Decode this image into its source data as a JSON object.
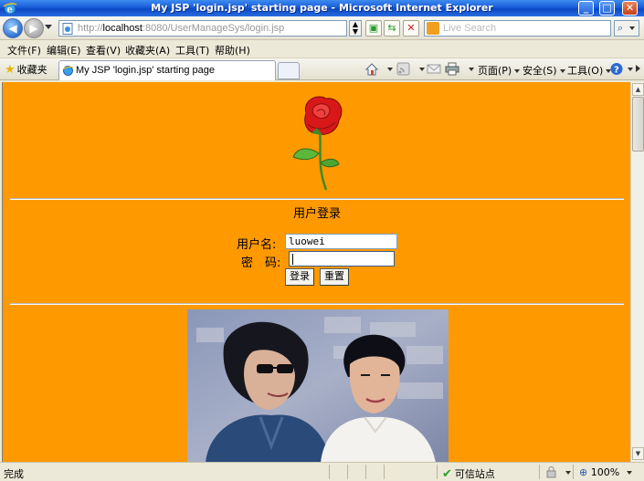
{
  "window": {
    "title": "My JSP 'login.jsp' starting page - Microsoft Internet Explorer",
    "minimize": "_",
    "maximize": "□",
    "close": "✕"
  },
  "addressbar": {
    "url_prefix": "http://",
    "url_host": "localhost",
    "url_rest": ":8080/UserManageSys/login.jsp",
    "search_placeholder": "Live Search"
  },
  "menu": {
    "file": "文件(F)",
    "edit": "编辑(E)",
    "view": "查看(V)",
    "favorites": "收藏夹(A)",
    "tools": "工具(T)",
    "help": "帮助(H)"
  },
  "tabbar": {
    "favorites_label": "收藏夹",
    "tab_title": "My JSP 'login.jsp' starting page",
    "page_menu": "页面(P)",
    "safety_menu": "安全(S)",
    "tools_menu": "工具(O)"
  },
  "login": {
    "heading": "用户登录",
    "username_label": "用户名:",
    "username_value": "luowei",
    "password_label": "密　码:",
    "password_value": "",
    "submit_label": "登录",
    "reset_label": "重置"
  },
  "statusbar": {
    "status": "完成",
    "zone": "可信站点",
    "zoom": "100%"
  },
  "colors": {
    "page_background": "#ff9900",
    "title_bar": "#0b48c4"
  }
}
